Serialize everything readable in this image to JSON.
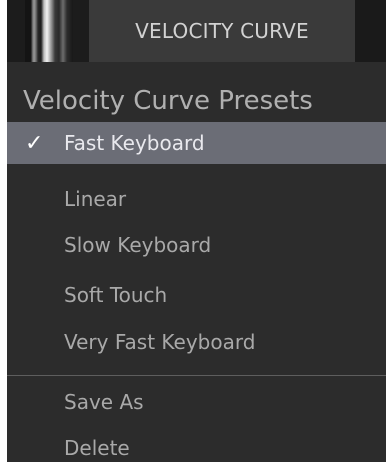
{
  "header": {
    "title": "VELOCITY CURVE"
  },
  "menu": {
    "heading": "Velocity Curve Presets",
    "check_icon": "✓",
    "presets": [
      {
        "label": "Fast Keyboard",
        "selected": true
      },
      {
        "label": "Linear",
        "selected": false
      },
      {
        "label": "Slow Keyboard",
        "selected": false
      },
      {
        "label": "Soft Touch",
        "selected": false
      },
      {
        "label": "Very Fast Keyboard",
        "selected": false
      }
    ],
    "actions": [
      {
        "label": "Save As"
      },
      {
        "label": "Delete"
      }
    ]
  },
  "colors": {
    "selected_highlight": "#6b6d76",
    "menu_background": "#2c2c2c",
    "text": "#a9a9a9"
  }
}
